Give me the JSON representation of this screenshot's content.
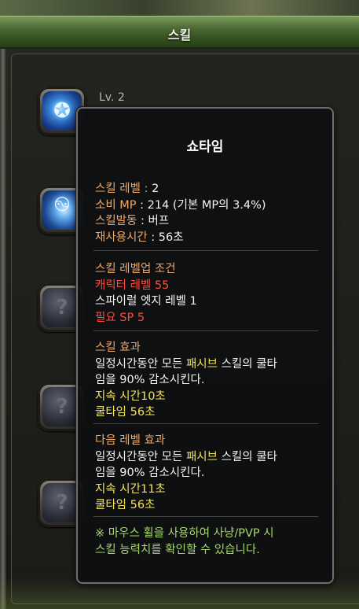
{
  "window": {
    "title": "스킬"
  },
  "skill_list": {
    "first_level": "Lv. 2"
  },
  "tooltip": {
    "name": "쇼타임",
    "info": {
      "level_label": "스킬 레벨 : ",
      "level_value": "2",
      "mp_label": "소비 MP",
      "mp_value": " : 214 (기본 MP의 3.4%)",
      "trigger_label": "스킬발동",
      "trigger_value": " : 버프",
      "cooldown_label": "재사용시간",
      "cooldown_value": " : 56초"
    },
    "requirements": {
      "header": "스킬 레벨업 조건",
      "char_level": "캐릭터 레벨 55",
      "prereq": "스파이럴 엣지 레벨 1",
      "sp": "필요 SP 5"
    },
    "effect": {
      "header": "스킬 효과",
      "line1_a": "일정시간동안 모든 ",
      "line1_b": "패시브",
      "line1_c": " 스킬의 쿨타",
      "line2": "임을 90% 감소시킨다.",
      "duration": "지속 시간10초",
      "cooldown": "쿨타임 56초"
    },
    "next_effect": {
      "header": "다음 레벨 효과",
      "line1_a": "일정시간동안 모든 ",
      "line1_b": "패시브",
      "line1_c": " 스킬의 쿨타",
      "line2": "임을 90% 감소시킨다.",
      "duration": "지속 시간11초",
      "cooldown": "쿨타임 56초"
    },
    "note": {
      "line1": "※ 마우스 휠을 사용하여 사냥/PVP 시",
      "line2": "스킬 능력치를 확인할 수 있습니다."
    }
  },
  "colors": {
    "header_orange": "#f0a868",
    "requirement_red": "#ff4a3c",
    "highlight_yellow": "#f2e45c",
    "note_green": "#a6d86a"
  }
}
